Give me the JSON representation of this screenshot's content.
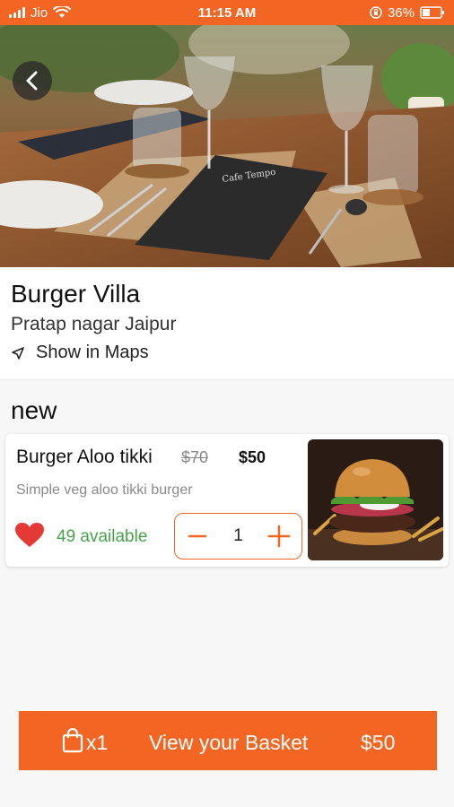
{
  "status_bar": {
    "carrier": "Jio",
    "time": "11:15 AM",
    "battery": "36%"
  },
  "restaurant": {
    "name": "Burger Villa",
    "location": "Pratap nagar Jaipur",
    "maps_link": "Show in Maps"
  },
  "section": {
    "title": "new"
  },
  "item": {
    "name": "Burger Aloo tikki",
    "old_price": "$70",
    "price": "$50",
    "description": "Simple veg aloo tikki burger",
    "availability": "49 available",
    "quantity": "1",
    "favorite": true
  },
  "basket": {
    "count": "x1",
    "label": "View your Basket",
    "total": "$50"
  },
  "colors": {
    "accent": "#f26522",
    "available_green": "#47a34b",
    "heart_red": "#e53935"
  },
  "icons": [
    "back-arrow-icon",
    "navigation-arrow-icon",
    "heart-icon",
    "minus-icon",
    "plus-icon",
    "shopping-bag-icon",
    "wifi-icon",
    "signal-icon",
    "battery-icon"
  ]
}
